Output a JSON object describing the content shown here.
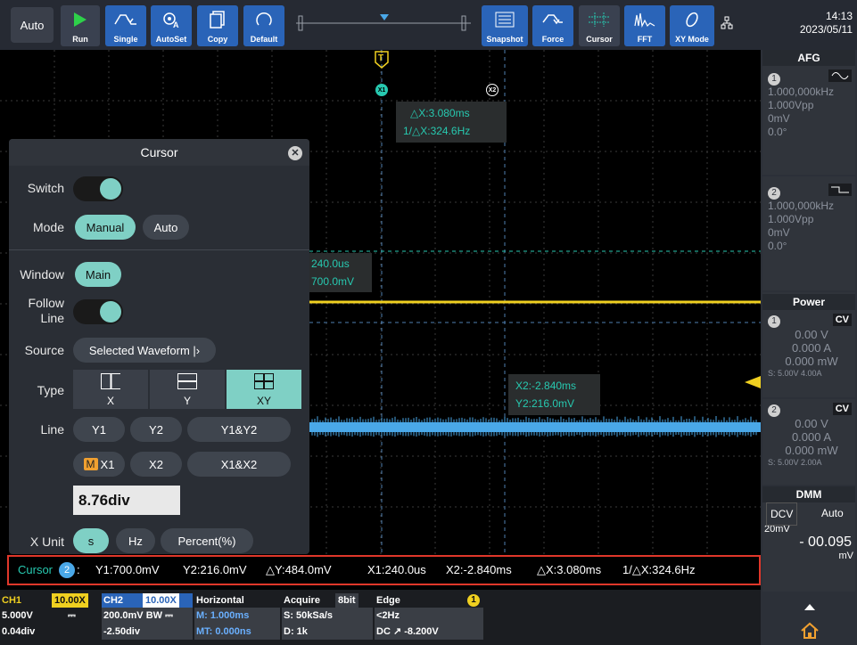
{
  "topbar": {
    "mode_label": "Auto",
    "buttons": {
      "run": "Run",
      "single": "Single",
      "autoset": "AutoSet",
      "copy": "Copy",
      "default": "Default",
      "snapshot": "Snapshot",
      "force": "Force",
      "cursor": "Cursor",
      "fft": "FFT",
      "xy_mode": "XY Mode"
    },
    "time": "14:13",
    "date": "2023/05/11"
  },
  "screen": {
    "trigger_marker": "T",
    "x1_marker": "X1",
    "x2_marker": "X2",
    "delta_x": "△X:3.080ms",
    "inv_delta_x": "1/△X:324.6Hz",
    "x1_label_time": "240.0us",
    "x1_label_value": "700.0mV",
    "x2_label_time": "X2:-2.840ms",
    "x2_label_value": "Y2:216.0mV",
    "colors": {
      "ch1": "#f0d020",
      "ch2": "#4aa8e8",
      "cursor": "#27c9b0"
    }
  },
  "cursor_panel": {
    "title": "Cursor",
    "close_icon": "close-icon",
    "switch_label": "Switch",
    "mode_label": "Mode",
    "mode_options": [
      "Manual",
      "Auto"
    ],
    "mode_selected": "Manual",
    "window_label": "Window",
    "window_value": "Main",
    "follow_line_label": [
      "Follow",
      "Line"
    ],
    "source_label": "Source",
    "source_value": "Selected Waveform |›",
    "type_label": "Type",
    "type_options": [
      "X",
      "Y",
      "XY"
    ],
    "type_selected": "XY",
    "line_label": "Line",
    "line_row1": [
      "Y1",
      "Y2",
      "Y1&Y2"
    ],
    "line_row2_badge": "M",
    "line_row2": [
      "X1",
      "X2",
      "X1&X2"
    ],
    "x1_label": "X1",
    "x1_value": "8.76div",
    "x_unit_label": "X Unit",
    "x_unit_options": [
      "s",
      "Hz",
      "Percent(%)"
    ]
  },
  "infobar": {
    "prefix": "Cursor",
    "badge": "2",
    "colon": ":",
    "y1": "Y1:700.0mV",
    "y2": "Y2:216.0mV",
    "dy": "△Y:484.0mV",
    "x1": "X1:240.0us",
    "x2": "X2:-2.840ms",
    "dx": "△X:3.080ms",
    "inv_dx": "1/△X:324.6Hz"
  },
  "bottombar": {
    "ch1": {
      "name": "CH1",
      "probe": "10.00X",
      "scale": "5.000V",
      "coupling": "⎓",
      "offset": "0.04div"
    },
    "ch2": {
      "name": "CH2",
      "probe": "10.00X",
      "scale": "200.0mV BW ⎓",
      "offset": "-2.50div"
    },
    "horizontal": {
      "name": "Horizontal",
      "main": "M: 1.000ms",
      "mt": "MT: 0.000ns"
    },
    "acquire": {
      "name": "Acquire",
      "bits": "8bit",
      "rate": "S: 50kSa/s",
      "depth": "D: 1k"
    },
    "trigger": {
      "name": "Edge",
      "channel": "1",
      "freq": "<2Hz",
      "level": "DC ↗ -8.200V"
    }
  },
  "right_panel": {
    "afg_title": "AFG",
    "afg1": {
      "num": "1",
      "freq": "1.000,000kHz",
      "amp": "1.000Vpp",
      "offset": "0mV",
      "phase": "0.0°",
      "wave_icon": "sine-wave-icon"
    },
    "afg2": {
      "num": "2",
      "freq": "1.000,000kHz",
      "amp": "1.000Vpp",
      "offset": "0mV",
      "phase": "0.0°",
      "wave_icon": "square-wave-icon"
    },
    "power_title": "Power",
    "power1": {
      "num": "1",
      "mode": "CV",
      "v": "0.00 V",
      "a": "0.000 A",
      "w": "0.000 mW",
      "set": "S: 5.00V 4.00A"
    },
    "power2": {
      "num": "2",
      "mode": "CV",
      "v": "0.00 V",
      "a": "0.000 A",
      "w": "0.000 mW",
      "set": "S: 5.00V 2.00A"
    },
    "dmm_title": "DMM",
    "dmm_mode": "DCV",
    "dmm_range": "Auto",
    "dmm_scale": "20mV",
    "dmm_value": "- 00.095",
    "dmm_unit": "mV",
    "home_icon": "home-icon"
  }
}
